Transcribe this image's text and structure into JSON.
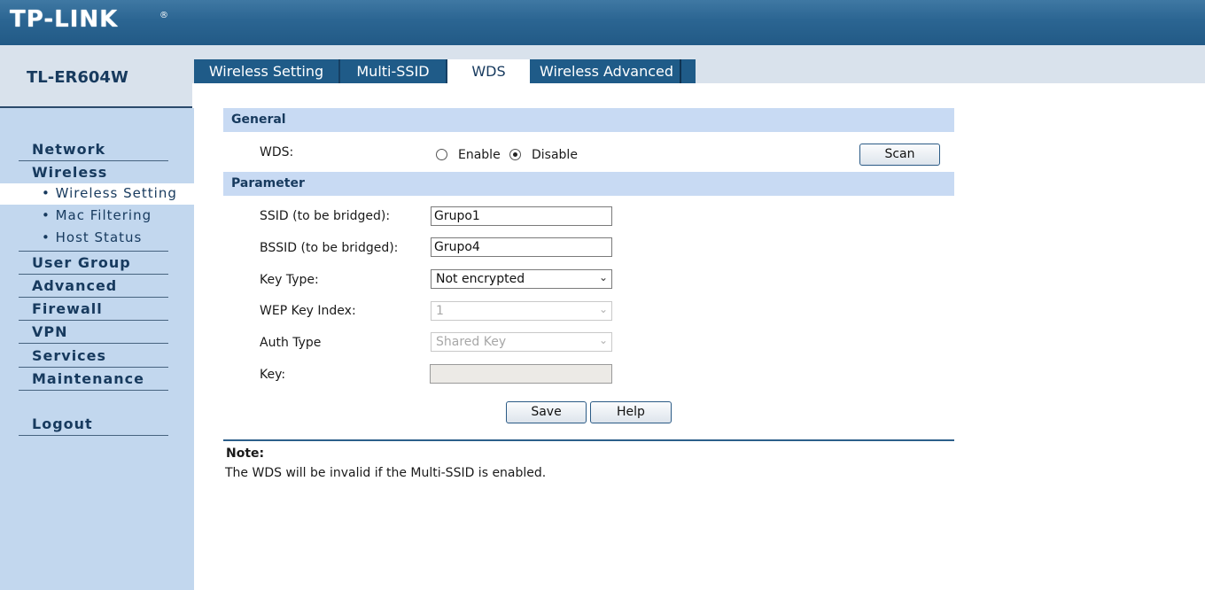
{
  "brand": {
    "logo": "TP-LINK",
    "registered": "®"
  },
  "model": "TL-ER604W",
  "tabs": [
    {
      "label": "Wireless Setting",
      "active": false
    },
    {
      "label": "Multi-SSID",
      "active": false
    },
    {
      "label": "WDS",
      "active": true
    },
    {
      "label": "Wireless Advanced",
      "active": false
    }
  ],
  "sidebar": {
    "items": [
      {
        "label": "Network"
      },
      {
        "label": "Wireless"
      },
      {
        "label": "User Group"
      },
      {
        "label": "Advanced"
      },
      {
        "label": "Firewall"
      },
      {
        "label": "VPN"
      },
      {
        "label": "Services"
      },
      {
        "label": "Maintenance"
      },
      {
        "label": "Logout"
      }
    ],
    "sub_items": [
      {
        "label": "• Wireless Setting",
        "active": true
      },
      {
        "label": "• Mac Filtering",
        "active": false
      },
      {
        "label": "• Host Status",
        "active": false
      }
    ]
  },
  "general": {
    "title": "General",
    "wds_label": "WDS:",
    "enable_label": "Enable",
    "disable_label": "Disable",
    "selected": "Disable",
    "scan_label": "Scan"
  },
  "parameter": {
    "title": "Parameter",
    "ssid_label": "SSID (to be bridged):",
    "ssid_value": "Grupo1",
    "bssid_label": "BSSID (to be bridged):",
    "bssid_value": "Grupo4",
    "key_type_label": "Key Type:",
    "key_type_value": "Not encrypted",
    "wep_key_index_label": "WEP Key Index:",
    "wep_key_index_value": "1",
    "auth_type_label": "Auth Type",
    "auth_type_value": "Shared Key",
    "key_label": "Key:",
    "key_value": ""
  },
  "actions": {
    "save_label": "Save",
    "help_label": "Help"
  },
  "note": {
    "title": "Note:",
    "text": "The WDS will be invalid if the Multi-SSID is enabled."
  },
  "colors": {
    "banner": "#2b6592",
    "sidebar": "#c2d7ee",
    "section_header": "#c8daf3",
    "text_dark_blue": "#173a5e"
  }
}
